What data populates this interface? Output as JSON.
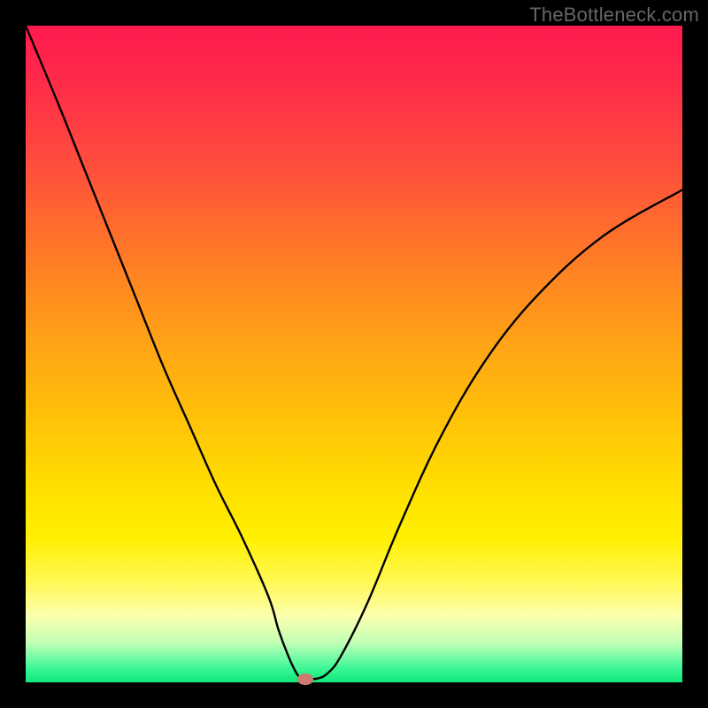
{
  "watermark": "TheBottleneck.com",
  "colors": {
    "frame": "#000000",
    "curve": "#000000",
    "marker": "#cc7a72"
  },
  "chart_data": {
    "type": "line",
    "title": "",
    "xlabel": "",
    "ylabel": "",
    "xlim": [
      0,
      100
    ],
    "ylim": [
      0,
      100
    ],
    "grid": false,
    "series": [
      {
        "name": "bottleneck-curve",
        "x": [
          0,
          5,
          9,
          13,
          17,
          21,
          25,
          29,
          33,
          37,
          38.5,
          40,
          41.3,
          42.2,
          43,
          44.5,
          46,
          48,
          52,
          57,
          63,
          70,
          78,
          88,
          100
        ],
        "values": [
          100,
          88,
          78,
          68,
          58,
          48,
          39,
          30,
          22,
          13,
          8,
          4,
          1.3,
          0.5,
          0.5,
          0.6,
          1.4,
          4,
          12,
          24,
          37,
          49,
          59,
          68,
          75
        ]
      }
    ],
    "marker": {
      "x": 42.6,
      "y": 0.5,
      "rx": 1.2,
      "ry": 0.9
    }
  }
}
